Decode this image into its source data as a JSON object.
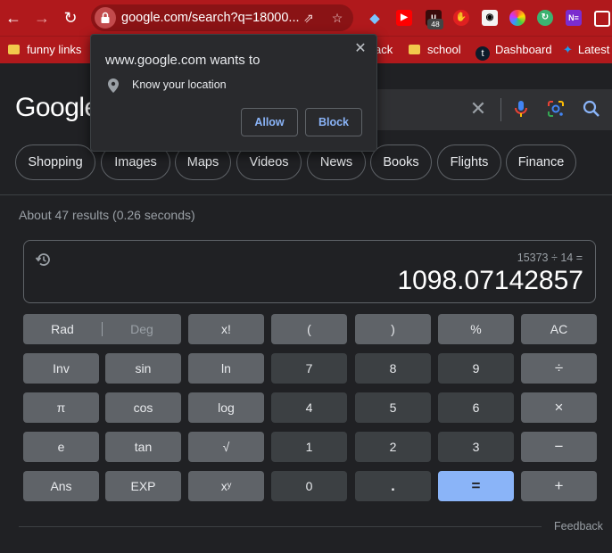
{
  "browser": {
    "url": "google.com/search?q=18000...",
    "extension_badge": "48",
    "extension_ne_label": "N≡"
  },
  "bookmarks": {
    "items": [
      {
        "label": "funny links"
      },
      {
        "label": "ack"
      },
      {
        "label": "school"
      },
      {
        "label": "Dashboard"
      },
      {
        "label": "Latest"
      }
    ]
  },
  "search": {
    "logo": "Google"
  },
  "chips": [
    "Shopping",
    "Images",
    "Maps",
    "Videos",
    "News",
    "Books",
    "Flights",
    "Finance"
  ],
  "results_stats": "About 47 results (0.26 seconds)",
  "calculator": {
    "expression": "15373 ÷ 14 =",
    "result": "1098.07142857",
    "rad": "Rad",
    "deg": "Deg",
    "keys": {
      "fact": "x!",
      "lparen": "(",
      "rparen": ")",
      "percent": "%",
      "ac": "AC",
      "inv": "Inv",
      "sin": "sin",
      "ln": "ln",
      "seven": "7",
      "eight": "8",
      "nine": "9",
      "divide": "÷",
      "pi": "π",
      "cos": "cos",
      "log": "log",
      "four": "4",
      "five": "5",
      "six": "6",
      "multiply": "×",
      "e": "e",
      "tan": "tan",
      "sqrt": "√",
      "one": "1",
      "two": "2",
      "three": "3",
      "minus": "−",
      "ans": "Ans",
      "exp": "EXP",
      "pow": "xʸ",
      "zero": "0",
      "dot": ".",
      "equals": "=",
      "plus": "+"
    }
  },
  "feedback": "Feedback",
  "permission_popup": {
    "title": "www.google.com wants to",
    "request": "Know your location",
    "allow": "Allow",
    "block": "Block"
  }
}
